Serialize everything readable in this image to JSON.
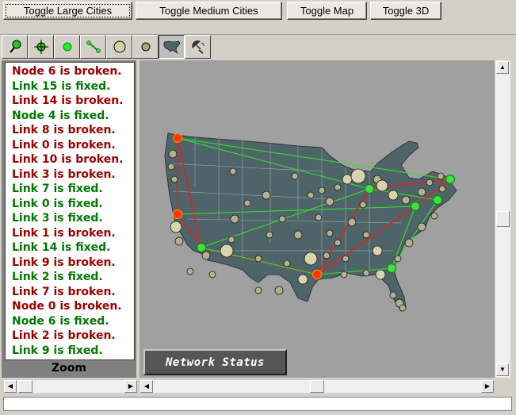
{
  "top_buttons": {
    "large_cities": "Toggle Large Cities",
    "medium_cities": "Toggle Medium Cities",
    "map": "Toggle Map",
    "three_d": "Toggle 3D"
  },
  "toolbar_icons": [
    "pin-icon",
    "crosshair-icon",
    "green-node-icon",
    "link-icon",
    "large-city-icon",
    "medium-city-icon",
    "usa-map-icon",
    "radar-dish-icon"
  ],
  "log": [
    {
      "text": "Node 6 is broken.",
      "status": "broken"
    },
    {
      "text": "Link 15 is fixed.",
      "status": "fixed"
    },
    {
      "text": "Link 14 is broken.",
      "status": "broken"
    },
    {
      "text": "Node 4 is fixed.",
      "status": "fixed"
    },
    {
      "text": "Link 8 is broken.",
      "status": "broken"
    },
    {
      "text": "Link 0 is broken.",
      "status": "broken"
    },
    {
      "text": "Link 10 is broken.",
      "status": "broken"
    },
    {
      "text": "Link 3 is broken.",
      "status": "broken"
    },
    {
      "text": "Link 7 is fixed.",
      "status": "fixed"
    },
    {
      "text": "Link 0 is fixed.",
      "status": "fixed"
    },
    {
      "text": "Link 3 is fixed.",
      "status": "fixed"
    },
    {
      "text": "Link 1 is broken.",
      "status": "broken"
    },
    {
      "text": "Link 14 is fixed.",
      "status": "fixed"
    },
    {
      "text": "Link 9 is broken.",
      "status": "broken"
    },
    {
      "text": "Link 2 is fixed.",
      "status": "fixed"
    },
    {
      "text": "Link 7 is broken.",
      "status": "broken"
    },
    {
      "text": "Node 0 is broken.",
      "status": "broken"
    },
    {
      "text": "Node 6 is fixed.",
      "status": "fixed"
    },
    {
      "text": "Link 2 is broken.",
      "status": "broken"
    },
    {
      "text": "Link 9 is fixed.",
      "status": "fixed"
    }
  ],
  "zoom_label": "Zoom",
  "network_status_label": "Network Status",
  "colors": {
    "broken": "#a00000",
    "fixed": "#007a00",
    "map_land": "#4f6468",
    "link_ok": "#33dd33",
    "link_broken": "#dd2222",
    "node_ok": "#44dd44",
    "node_broken": "#ff3300",
    "city": "#c8c4a0"
  }
}
